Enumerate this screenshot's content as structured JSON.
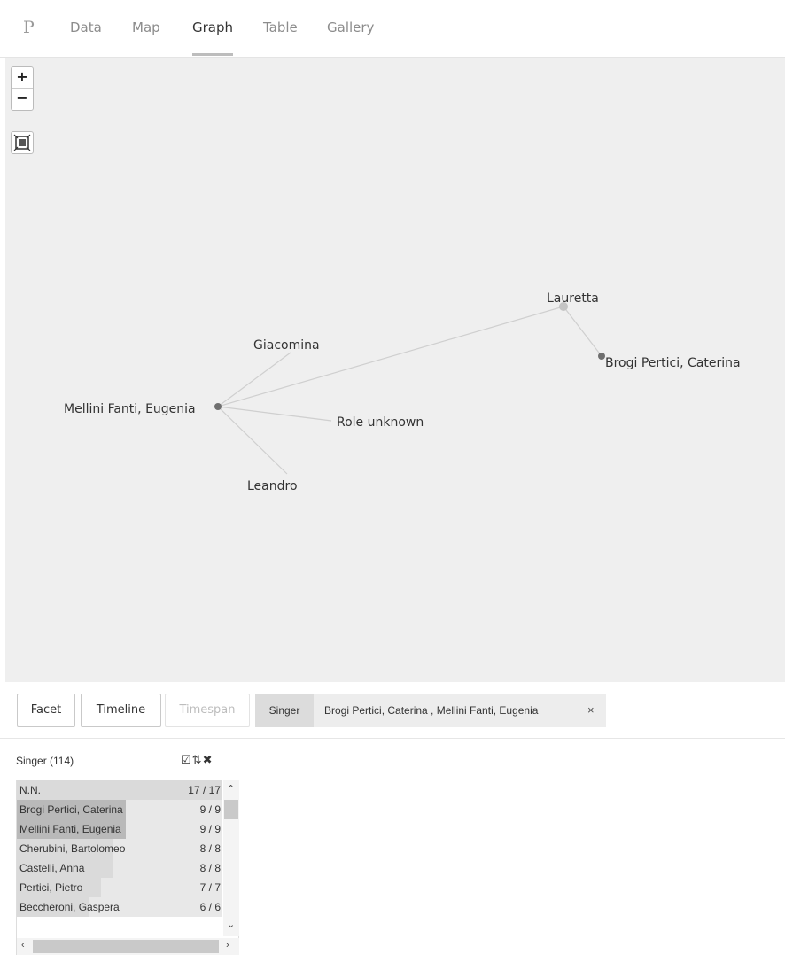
{
  "nav": {
    "logo": "P",
    "tabs": [
      {
        "label": "Data",
        "active": false
      },
      {
        "label": "Map",
        "active": false
      },
      {
        "label": "Graph",
        "active": true
      },
      {
        "label": "Table",
        "active": false
      },
      {
        "label": "Gallery",
        "active": false
      }
    ]
  },
  "zoom": {
    "in_label": "+",
    "out_label": "−",
    "fit_icon": "fit-to-screen-icon"
  },
  "graph": {
    "nodes": [
      {
        "id": "mellini",
        "label": "Mellini Fanti, Eugenia"
      },
      {
        "id": "giacomina",
        "label": "Giacomina"
      },
      {
        "id": "role_unknown",
        "label": "Role unknown"
      },
      {
        "id": "leandro",
        "label": "Leandro"
      },
      {
        "id": "lauretta",
        "label": "Lauretta"
      },
      {
        "id": "brogi",
        "label": "Brogi Pertici, Caterina"
      }
    ],
    "edges": [
      [
        "mellini",
        "giacomina"
      ],
      [
        "mellini",
        "role_unknown"
      ],
      [
        "mellini",
        "leandro"
      ],
      [
        "mellini",
        "lauretta"
      ],
      [
        "lauretta",
        "brogi"
      ]
    ],
    "colors": {
      "background": "#efefef",
      "edge": "#cfcfcf",
      "person_node": "#6f6f6f",
      "role_node": "#c4c4c4"
    }
  },
  "toolbar": {
    "facet_label": "Facet",
    "timeline_label": "Timeline",
    "timespan_label": "Timespan",
    "filter_key": "Singer",
    "filter_value": "Brogi Pertici, Caterina , Mellini Fanti, Eugenia",
    "filter_remove": "×"
  },
  "facet": {
    "title": "Singer (114)",
    "rows": [
      {
        "name": "N.N.",
        "count": "17 / 17",
        "selected": false
      },
      {
        "name": "Brogi Pertici, Caterina",
        "count": "9 / 9",
        "selected": true
      },
      {
        "name": "Mellini Fanti, Eugenia",
        "count": "9 / 9",
        "selected": true
      },
      {
        "name": "Cherubini, Bartolomeo",
        "count": "8 / 8",
        "selected": false
      },
      {
        "name": "Castelli, Anna",
        "count": "8 / 8",
        "selected": false
      },
      {
        "name": "Pertici, Pietro",
        "count": "7 / 7",
        "selected": false
      },
      {
        "name": "Beccheroni, Gaspera",
        "count": "6 / 6",
        "selected": false
      }
    ],
    "bar_fraction": [
      1.0,
      0.53,
      0.53,
      0.47,
      0.47,
      0.41,
      0.35
    ]
  }
}
